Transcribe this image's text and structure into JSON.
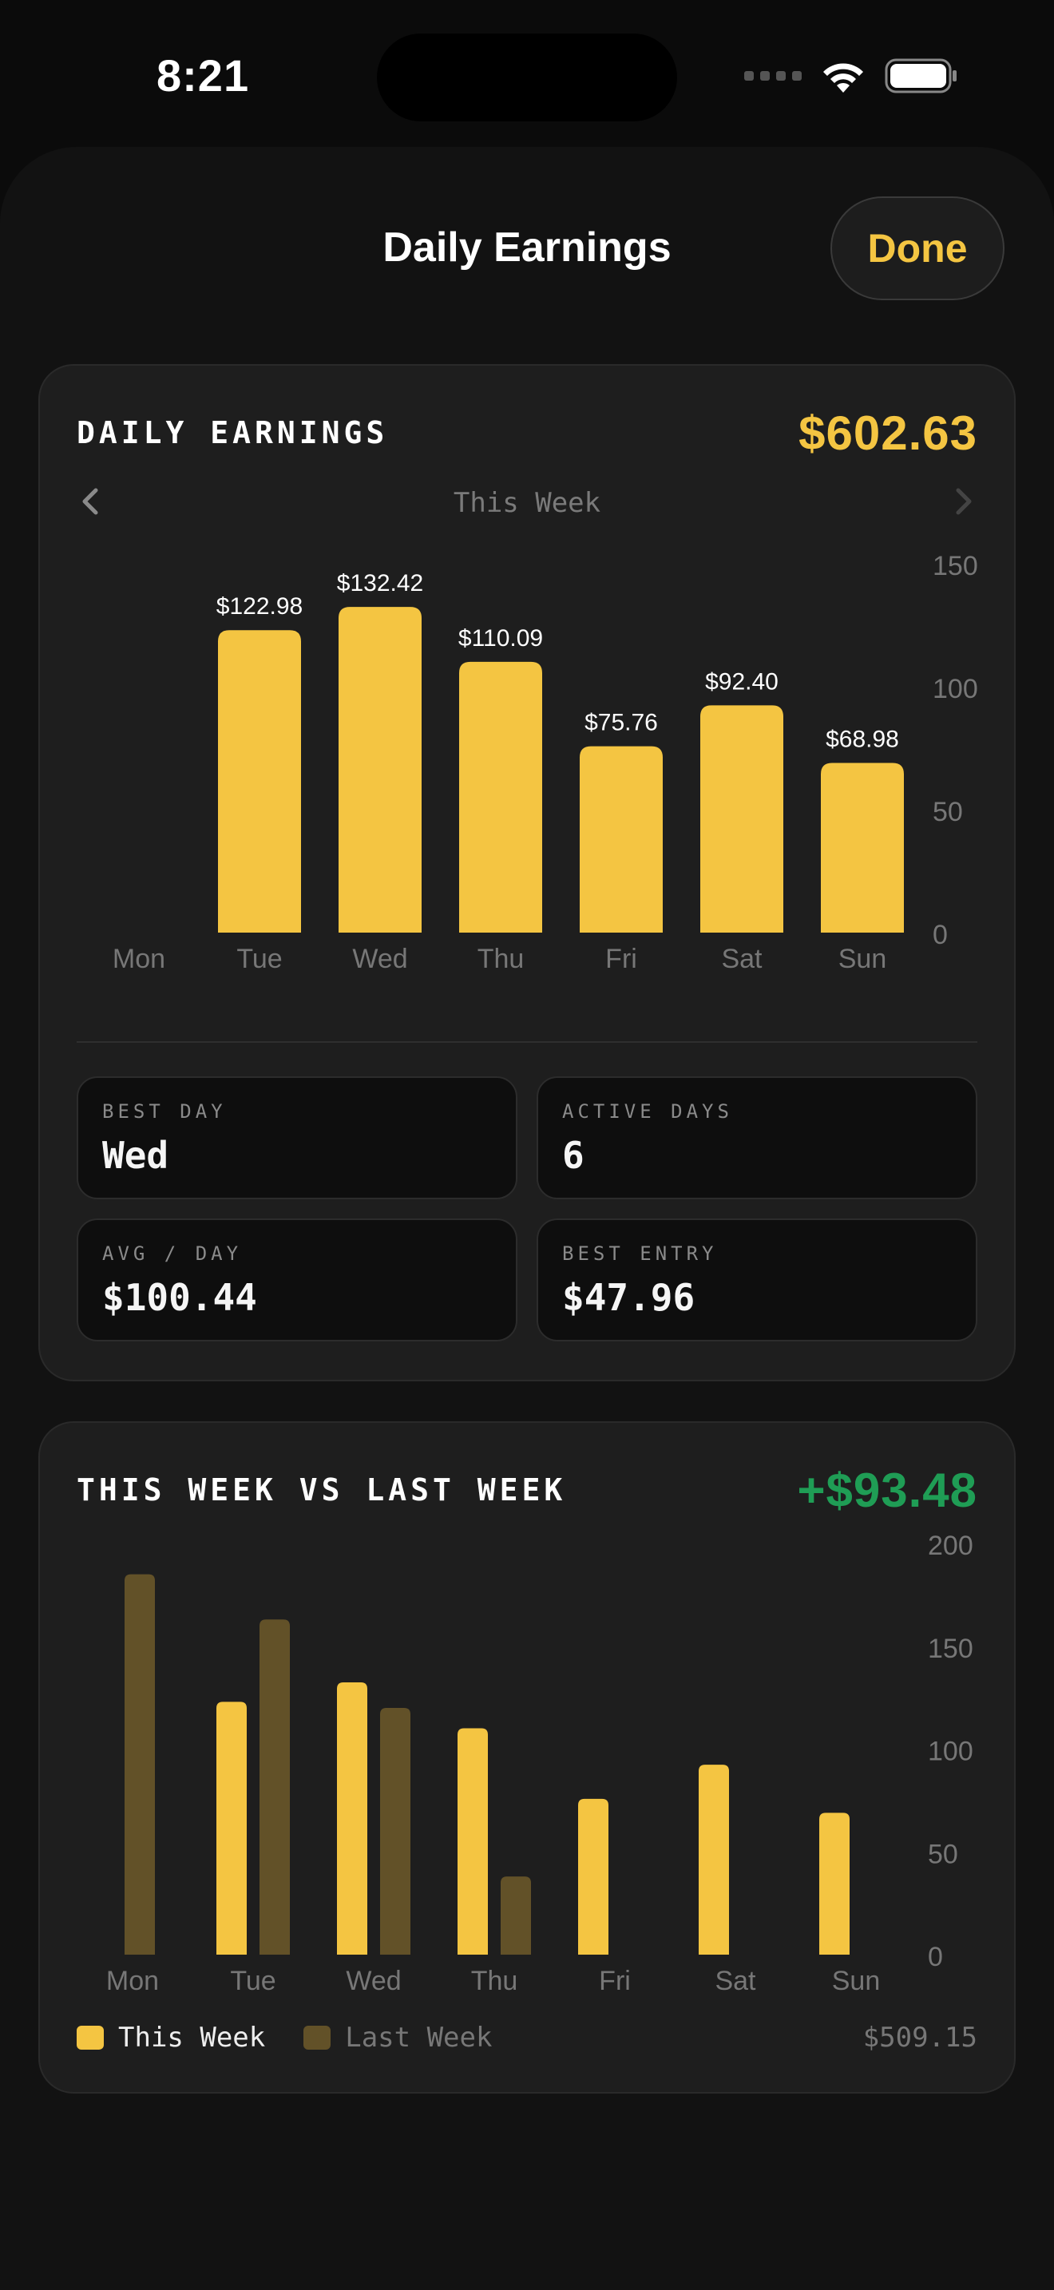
{
  "status_bar": {
    "time": "8:21"
  },
  "sheet": {
    "title": "Daily Earnings",
    "done_label": "Done"
  },
  "daily_card": {
    "title": "DAILY EARNINGS",
    "total": "$602.63",
    "week_label": "This Week",
    "stats": [
      {
        "label": "BEST DAY",
        "value": "Wed"
      },
      {
        "label": "ACTIVE DAYS",
        "value": "6"
      },
      {
        "label": "AVG / DAY",
        "value": "$100.44"
      },
      {
        "label": "BEST ENTRY",
        "value": "$47.96"
      }
    ]
  },
  "compare_card": {
    "title": "THIS WEEK VS LAST WEEK",
    "delta": "+$93.48",
    "legend_this": "This Week",
    "legend_last": "Last Week",
    "last_week_total": "$509.15"
  },
  "colors": {
    "accent": "#f4c542",
    "last_week": "#625128",
    "positive": "#1f9d55",
    "axis_text": "#777777"
  },
  "chart_data": [
    {
      "type": "bar",
      "categories": [
        "Mon",
        "Tue",
        "Wed",
        "Thu",
        "Fri",
        "Sat",
        "Sun"
      ],
      "values": [
        0,
        122.98,
        132.42,
        110.09,
        75.76,
        92.4,
        68.98
      ],
      "data_labels": [
        "",
        "$122.98",
        "$132.42",
        "$110.09",
        "$75.76",
        "$92.40",
        "$68.98"
      ],
      "yticks": [
        0,
        50,
        100,
        150
      ],
      "ylim": [
        0,
        150
      ],
      "title": "",
      "xlabel": "",
      "ylabel": ""
    },
    {
      "type": "bar",
      "categories": [
        "Mon",
        "Tue",
        "Wed",
        "Thu",
        "Fri",
        "Sat",
        "Sun"
      ],
      "series": [
        {
          "name": "This Week",
          "values": [
            0,
            122.98,
            132.42,
            110.09,
            75.76,
            92.4,
            68.98
          ]
        },
        {
          "name": "Last Week",
          "values": [
            185,
            163,
            120,
            38,
            0,
            0,
            0
          ]
        }
      ],
      "yticks": [
        0,
        50,
        100,
        150,
        200
      ],
      "ylim": [
        0,
        200
      ],
      "title": "",
      "xlabel": "",
      "ylabel": ""
    }
  ]
}
